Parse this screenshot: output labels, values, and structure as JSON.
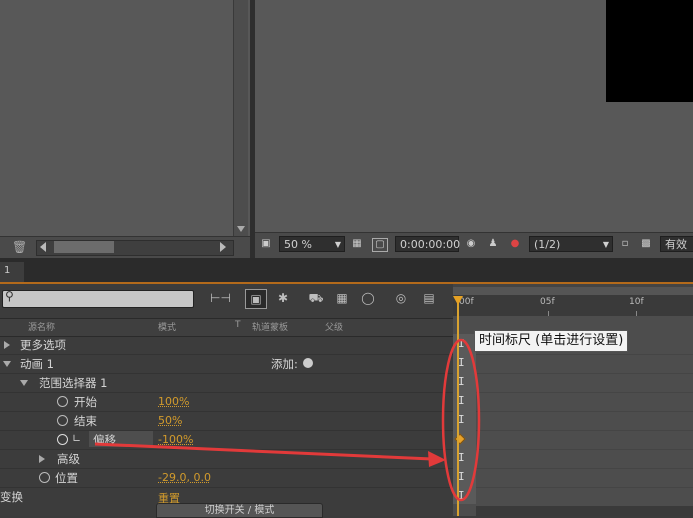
{
  "viewer_toolbar": {
    "zoom": "50 %",
    "timecode": "0:00:00:00",
    "resolution": "(1/2)",
    "view_label": "有效"
  },
  "tab": {
    "label": "1",
    "close": "×"
  },
  "columns": {
    "source_name": "源名称",
    "mode": "模式",
    "t": "T",
    "trkmat": "轨道蒙板",
    "parent": "父级"
  },
  "layers": {
    "more_options": "更多选项",
    "animator": "动画 1",
    "add_label": "添加:",
    "range_selector": "范围选择器 1",
    "start": {
      "label": "开始",
      "value": "100%"
    },
    "end": {
      "label": "结束",
      "value": "50%"
    },
    "offset": {
      "label": "偏移",
      "value": "-100%"
    },
    "advanced": "高级",
    "position": {
      "label": "位置",
      "value": "-29.0, 0.0"
    },
    "transform": {
      "label": "变换",
      "value": "重置"
    }
  },
  "bottom": {
    "toggle_label": "切换开关 / 模式"
  },
  "ruler": {
    "labels": [
      "00f",
      "05f",
      "10f"
    ]
  },
  "tooltip": "时间标尺 (单击进行设置)",
  "colors": {
    "accent_orange": "#d29b2c",
    "annotation_red": "#e23a3a"
  }
}
